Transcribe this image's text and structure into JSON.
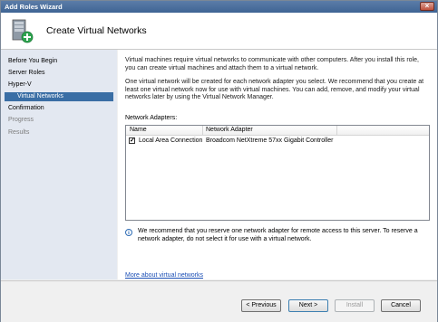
{
  "window": {
    "title": "Add Roles Wizard"
  },
  "header": {
    "title": "Create Virtual Networks",
    "icon": "server-roles-add-icon"
  },
  "nav": {
    "items": [
      {
        "label": "Before You Begin",
        "state": "normal"
      },
      {
        "label": "Server Roles",
        "state": "normal"
      },
      {
        "label": "Hyper-V",
        "state": "normal"
      },
      {
        "label": "Virtual Networks",
        "state": "selected"
      },
      {
        "label": "Confirmation",
        "state": "normal"
      },
      {
        "label": "Progress",
        "state": "disabled"
      },
      {
        "label": "Results",
        "state": "disabled"
      }
    ]
  },
  "content": {
    "para1": "Virtual machines require virtual networks to communicate with other computers. After you install this role, you can create virtual machines and attach them to a virtual network.",
    "para2": "One virtual network will be created for each network adapter you select. We recommend that you create at least one virtual network now for use with virtual machines. You can add, remove, and modify your virtual networks later by using the Virtual Network Manager.",
    "adapters_label": "Network Adapters:",
    "table": {
      "columns": [
        "Name",
        "Network Adapter"
      ],
      "rows": [
        {
          "checked": true,
          "name": "Local Area Connection",
          "adapter": "Broadcom NetXtreme 57xx Gigabit Controller"
        }
      ]
    },
    "info": "We recommend that you reserve one network adapter for remote access to this server. To reserve a network adapter, do not select it for use with a virtual network.",
    "link": "More about virtual networks"
  },
  "footer": {
    "previous": "< Previous",
    "next": "Next >",
    "install": "Install",
    "cancel": "Cancel"
  },
  "colors": {
    "titlebar": "#3f6494",
    "nav_background": "#e3e8f1",
    "nav_selected": "#3a6ea5",
    "link": "#1a4eb5"
  }
}
